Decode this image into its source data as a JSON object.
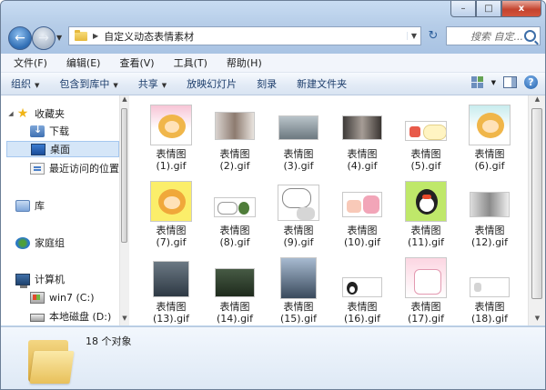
{
  "window": {
    "caption_buttons": {
      "minimize": "–",
      "maximize": "□",
      "close": "x"
    }
  },
  "address_bar": {
    "path": "自定义动态表情素材",
    "separator": "▶",
    "dropdown": "▼"
  },
  "search": {
    "placeholder": "搜索 自定..."
  },
  "menu": [
    "文件(F)",
    "编辑(E)",
    "查看(V)",
    "工具(T)",
    "帮助(H)"
  ],
  "commands": [
    "组织",
    "包含到库中",
    "共享",
    "放映幻灯片",
    "刻录",
    "新建文件夹"
  ],
  "sidebar": {
    "favorites_label": "收藏夹",
    "favorites": [
      "下载",
      "桌面",
      "最近访问的位置"
    ],
    "library": "库",
    "homegroup": "家庭组",
    "computer": "计算机",
    "drives": [
      "win7 (C:)",
      "本地磁盘 (D:)"
    ]
  },
  "files": [
    {
      "name": "表情图",
      "ext": "(1).gif"
    },
    {
      "name": "表情图",
      "ext": "(2).gif"
    },
    {
      "name": "表情图",
      "ext": "(3).gif"
    },
    {
      "name": "表情图",
      "ext": "(4).gif"
    },
    {
      "name": "表情图",
      "ext": "(5).gif"
    },
    {
      "name": "表情图",
      "ext": "(6).gif"
    },
    {
      "name": "表情图",
      "ext": "(7).gif"
    },
    {
      "name": "表情图",
      "ext": "(8).gif"
    },
    {
      "name": "表情图",
      "ext": "(9).gif"
    },
    {
      "name": "表情图",
      "ext": "(10).gif"
    },
    {
      "name": "表情图",
      "ext": "(11).gif"
    },
    {
      "name": "表情图",
      "ext": "(12).gif"
    },
    {
      "name": "表情图",
      "ext": "(13).gif"
    },
    {
      "name": "表情图",
      "ext": "(14).gif"
    },
    {
      "name": "表情图",
      "ext": "(15).gif"
    },
    {
      "name": "表情图",
      "ext": "(16).gif"
    },
    {
      "name": "表情图",
      "ext": "(17).gif"
    },
    {
      "name": "表情图",
      "ext": "(18).gif"
    }
  ],
  "status": {
    "item_count": "18 个对象"
  }
}
